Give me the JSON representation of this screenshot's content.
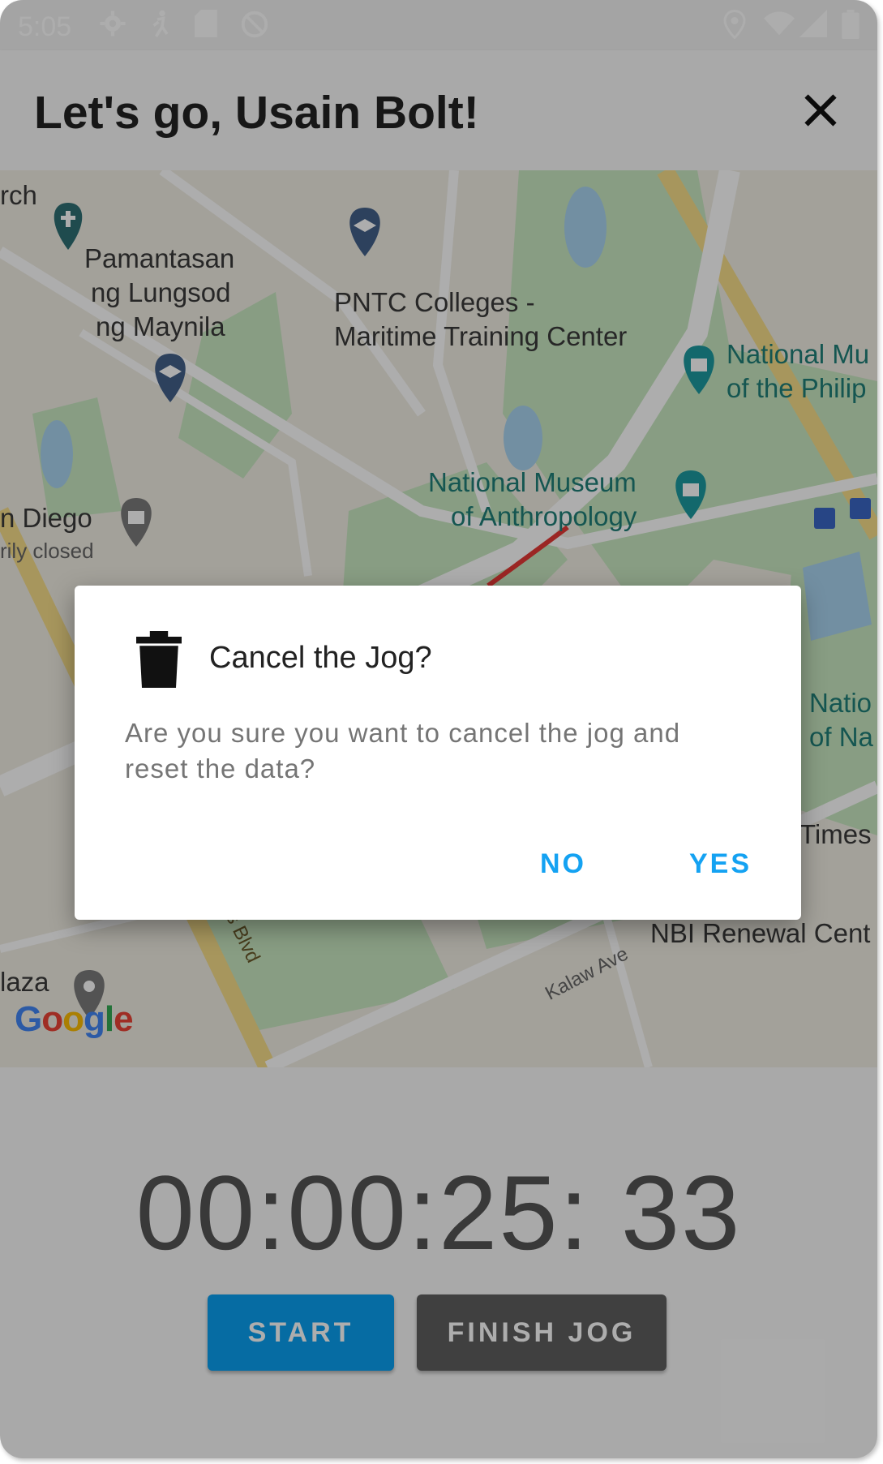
{
  "status_bar": {
    "time": "5:05",
    "icons": [
      "gear-icon",
      "running-person-icon",
      "sd-card-icon",
      "no-sync-icon",
      "location-icon",
      "wifi-icon",
      "cell-signal-icon",
      "battery-icon"
    ]
  },
  "app_bar": {
    "title": "Let's go, Usain Bolt!",
    "close_icon": "close-icon"
  },
  "map": {
    "labels": {
      "church": "rch",
      "plm_1": "Pamantasan",
      "plm_2": "ng Lungsod",
      "plm_3": "ng Maynila",
      "pntc_1": "PNTC Colleges -",
      "pntc_2": "Maritime Training Center",
      "natmus_1": "National Mu",
      "natmus_2": "of the Philip",
      "anthro_1": "National Museum",
      "anthro_2": "of Anthropology",
      "sandiego_1": "n Diego",
      "sandiego_2": "rily closed",
      "natio_1": "Natio",
      "natio_2": "of Na",
      "times": "Times",
      "nbi": "NBI Renewal Cent",
      "plaza": "laza",
      "road_roxas": "Roxas Blvd",
      "road_kalaw": "Kalaw Ave",
      "google": "Google"
    },
    "route_color": "#e53935"
  },
  "timer": {
    "value": "00:00:25: 33"
  },
  "buttons": {
    "start": "START",
    "finish": "FINISH JOG"
  },
  "dialog": {
    "icon": "trash-icon",
    "title": "Cancel the Jog?",
    "message": "Are you sure you want to cancel the jog and reset the data?",
    "no": "NO",
    "yes": "YES"
  },
  "colors": {
    "accent": "#14a2f2",
    "start_button": "#0a9ff0",
    "finish_button": "#5f5f5f"
  }
}
